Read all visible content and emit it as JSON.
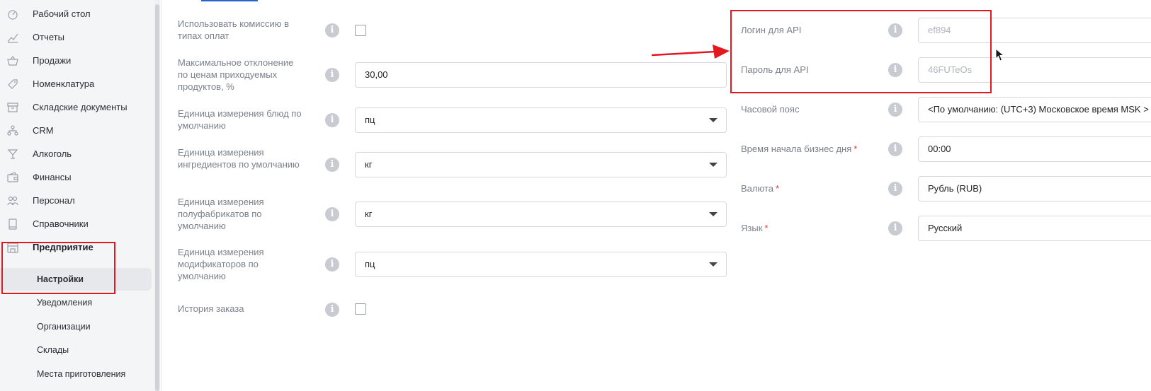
{
  "sidebar": {
    "items": [
      {
        "label": "Рабочий стол",
        "icon": "dashboard-icon"
      },
      {
        "label": "Отчеты",
        "icon": "chart-icon"
      },
      {
        "label": "Продажи",
        "icon": "basket-icon"
      },
      {
        "label": "Номенклатура",
        "icon": "tag-icon"
      },
      {
        "label": "Складские документы",
        "icon": "archive-icon"
      },
      {
        "label": "CRM",
        "icon": "people-tree-icon"
      },
      {
        "label": "Алкоголь",
        "icon": "cocktail-icon"
      },
      {
        "label": "Финансы",
        "icon": "wallet-icon"
      },
      {
        "label": "Персонал",
        "icon": "staff-icon"
      },
      {
        "label": "Справочники",
        "icon": "book-icon"
      },
      {
        "label": "Предприятие",
        "icon": "store-icon"
      }
    ],
    "sub_items": [
      {
        "label": "Настройки"
      },
      {
        "label": "Уведомления"
      },
      {
        "label": "Организации"
      },
      {
        "label": "Склады"
      },
      {
        "label": "Места приготовления"
      }
    ]
  },
  "left_form": {
    "commission_label": "Использовать комиссию в типах оплат",
    "max_deviation_label": "Максимальное отклонение по ценам приходуемых продуктов, %",
    "max_deviation_value": "30,00",
    "dish_unit_label": "Единица измерения блюд по умолчанию",
    "dish_unit_value": "пц",
    "ingredient_unit_label": "Единица измерения ингредиентов по умолчанию",
    "ingredient_unit_value": "кг",
    "semi_unit_label": "Единица измерения полуфабрикатов по умолчанию",
    "semi_unit_value": "кг",
    "modifier_unit_label": "Единица измерения модификаторов по умолчанию",
    "modifier_unit_value": "пц",
    "order_history_label": "История заказа"
  },
  "right_form": {
    "api_login_label": "Логин для API",
    "api_login_value": "ef894",
    "api_password_label": "Пароль для API",
    "api_password_value": "46FUTeOs",
    "timezone_label": "Часовой пояс",
    "timezone_value": "<По умолчанию: (UTC+3) Московское время MSK >",
    "business_day_label": "Время начала бизнес дня",
    "business_day_value": "00:00",
    "currency_label": "Валюта",
    "currency_value": "Рубль (RUB)",
    "language_label": "Язык",
    "language_value": "Русский",
    "required_mark": "*"
  },
  "info_glyph": "i",
  "colors": {
    "annotation_red": "#e3191f",
    "accent_blue": "#2563c9"
  }
}
